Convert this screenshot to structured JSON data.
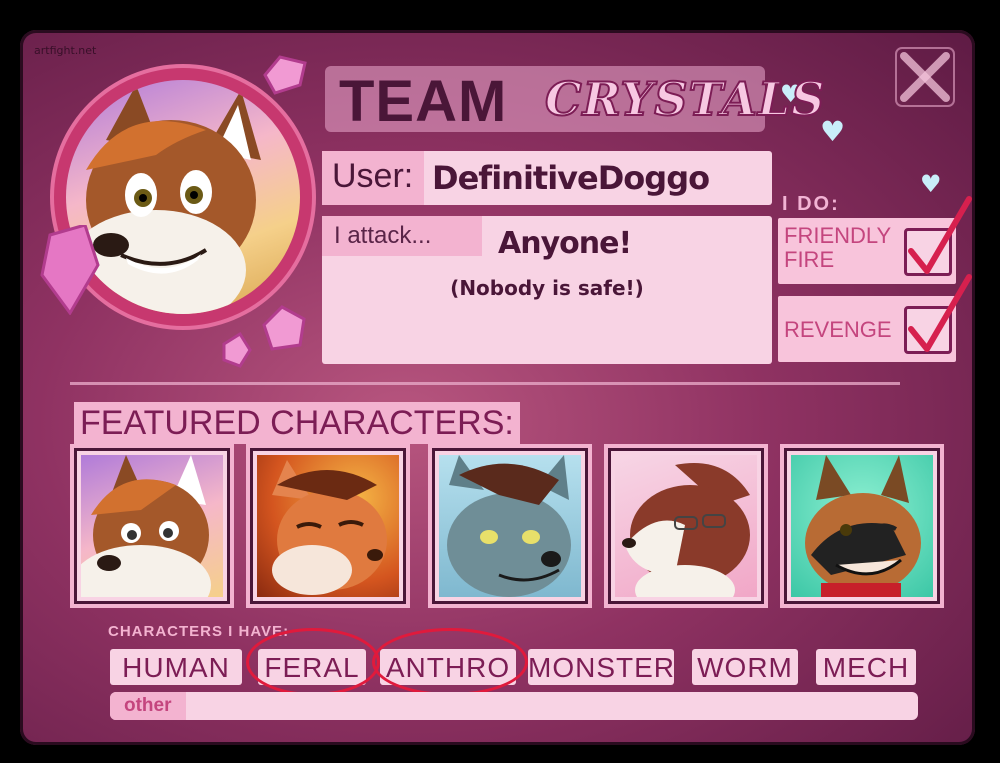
{
  "watermark": "artfight.net",
  "team": {
    "prefix": "TEAM",
    "name": "CRYSTALS",
    "accent": "#c7386f"
  },
  "user": {
    "label": "User:",
    "value": "DefinitiveDoggo"
  },
  "attack": {
    "label": "I attack...",
    "value": "Anyone!",
    "note": "(Nobody is safe!)"
  },
  "i_do": {
    "label": "I DO:",
    "options": [
      {
        "label_line1": "FRIENDLY",
        "label_line2": "FIRE",
        "checked": true
      },
      {
        "label_line1": "REVENGE",
        "label_line2": "",
        "checked": true
      }
    ]
  },
  "featured": {
    "title": "FEATURED CHARACTERS:",
    "characters": [
      {
        "icon": "brown-white-fox-portrait",
        "bg": "#e8a4d6"
      },
      {
        "icon": "orange-fox-portrait",
        "bg": "#e6783a"
      },
      {
        "icon": "grey-wolf-portrait",
        "bg": "#9fd6e8"
      },
      {
        "icon": "red-white-dog-portrait",
        "bg": "#f4c4da"
      },
      {
        "icon": "black-brown-shepherd-portrait",
        "bg": "#4fd6b4"
      }
    ]
  },
  "types": {
    "label": "CHARACTERS I HAVE:",
    "items": [
      {
        "label": "HUMAN",
        "circled": false
      },
      {
        "label": "FERAL",
        "circled": true
      },
      {
        "label": "ANTHRO",
        "circled": true
      },
      {
        "label": "MONSTER",
        "circled": false
      },
      {
        "label": "WORM",
        "circled": false
      },
      {
        "label": "MECH",
        "circled": false
      }
    ],
    "other_label": "other",
    "other_value": ""
  }
}
